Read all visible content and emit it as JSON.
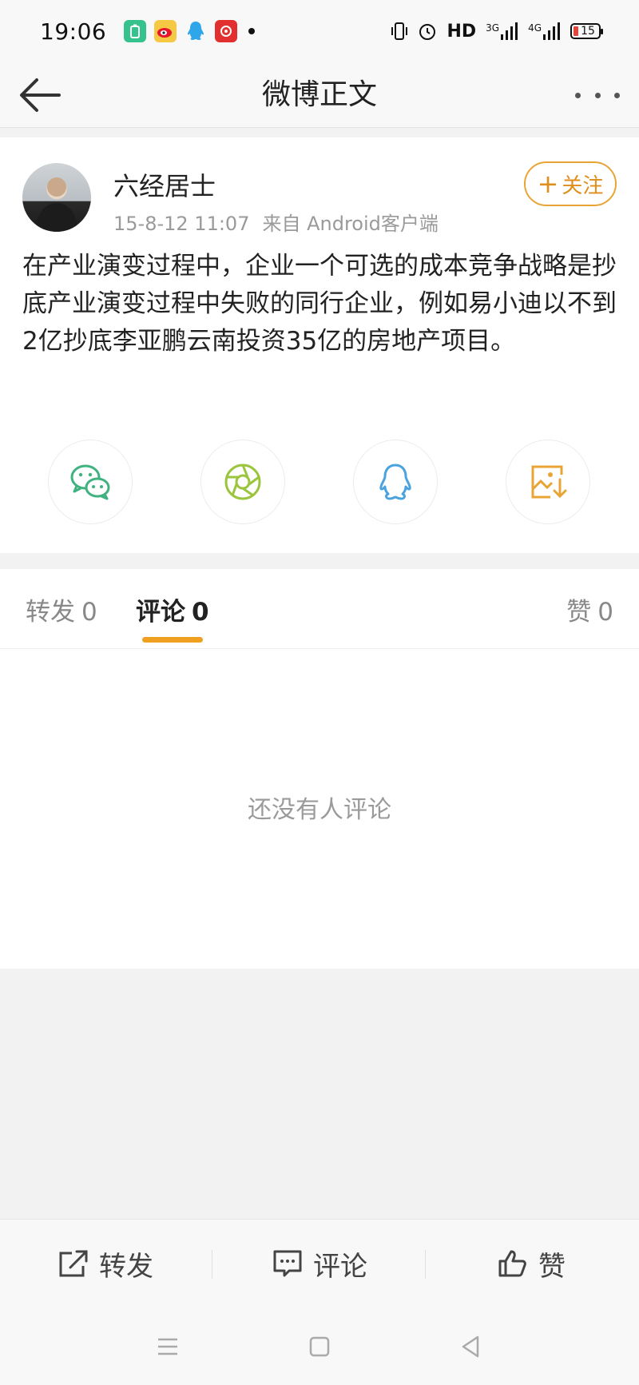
{
  "status_bar": {
    "time": "19:06",
    "hd_label": "HD",
    "signal1_label": "3G",
    "signal2_label": "4G",
    "battery_level": "15"
  },
  "nav": {
    "title": "微博正文"
  },
  "post": {
    "author": "六经居士",
    "date": "15-8-12 11:07",
    "source": "来自 Android客户端",
    "follow_label": "关注",
    "content": "在产业演变过程中，企业一个可选的成本竞争战略是抄底产业演变过程中失败的同行企业，例如易小迪以不到2亿抄底李亚鹏云南投资35亿的房地产项目。"
  },
  "tabs": {
    "repost_label": "转发",
    "repost_count": "0",
    "comment_label": "评论",
    "comment_count": "0",
    "like_label": "赞",
    "like_count": "0"
  },
  "comments": {
    "empty_text": "还没有人评论"
  },
  "actions": {
    "repost": "转发",
    "comment": "评论",
    "like": "赞"
  },
  "colors": {
    "accent": "#f0a020",
    "wechat": "#3fb27f",
    "moments": "#9bc53d",
    "qq": "#4aa3df",
    "save": "#e8a536"
  },
  "icons": [
    "back-arrow-icon",
    "more-icon",
    "wechat-icon",
    "moments-icon",
    "qq-icon",
    "save-image-icon",
    "repost-icon",
    "comment-icon",
    "like-icon"
  ]
}
